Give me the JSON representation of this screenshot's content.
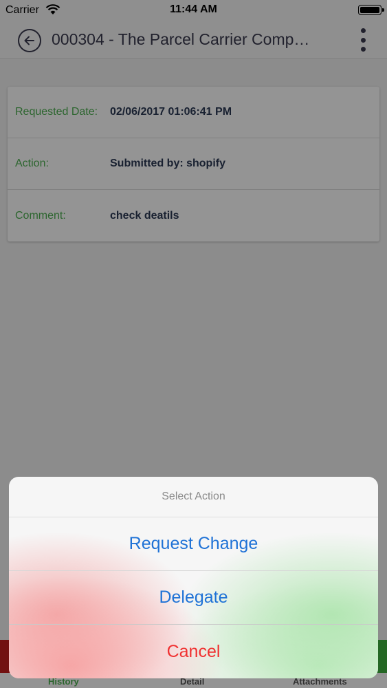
{
  "status_bar": {
    "carrier": "Carrier",
    "time": "11:44 AM"
  },
  "nav": {
    "title": "000304 - The Parcel Carrier Comp…"
  },
  "details": [
    {
      "label": "Requested Date:",
      "value": "02/06/2017 01:06:41 PM"
    },
    {
      "label": "Action:",
      "value": "Submitted by: shopify"
    },
    {
      "label": "Comment:",
      "value": "check deatils"
    }
  ],
  "tabs": [
    {
      "label": "History",
      "active": true
    },
    {
      "label": "Detail",
      "active": false
    },
    {
      "label": "Attachments",
      "active": false
    }
  ],
  "action_sheet": {
    "title": "Select Action",
    "options": [
      "Request Change",
      "Delegate"
    ],
    "cancel": "Cancel"
  },
  "colors": {
    "label_green": "#4caf50",
    "value_navy": "#2c3a55",
    "action_blue": "#1f72d6",
    "destructive_red": "#f03030",
    "stripe_red": "#c41e1e",
    "stripe_green": "#3fb23f"
  },
  "icons": {
    "back": "back-arrow-circle-icon",
    "more": "more-vertical-icon",
    "wifi": "wifi-icon",
    "battery": "battery-icon"
  }
}
